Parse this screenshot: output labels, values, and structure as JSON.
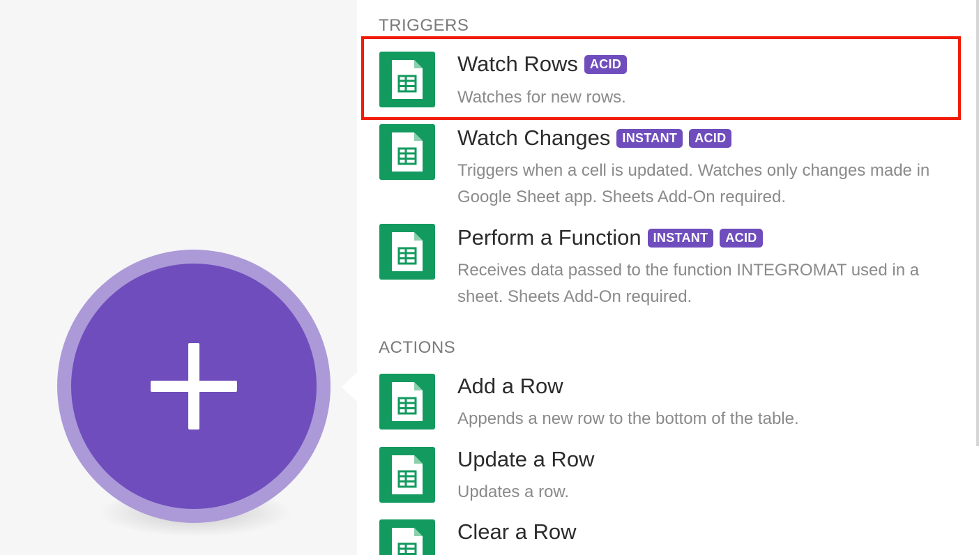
{
  "colors": {
    "accent": "#6f4dbd",
    "accent_ring": "#ac9ad8",
    "sheets_green": "#139a5f",
    "highlight": "#f21b05"
  },
  "add_module": {
    "icon": "plus-icon"
  },
  "triggers": {
    "title": "TRIGGERS",
    "items": [
      {
        "title": "Watch Rows",
        "badges": [
          "ACID"
        ],
        "description": "Watches for new rows.",
        "icon": "google-sheets-icon",
        "highlighted": true
      },
      {
        "title": "Watch Changes",
        "badges": [
          "INSTANT",
          "ACID"
        ],
        "description": "Triggers when a cell is updated. Watches only changes made in Google Sheet app. Sheets Add-On required.",
        "icon": "google-sheets-icon"
      },
      {
        "title": "Perform a Function",
        "badges": [
          "INSTANT",
          "ACID"
        ],
        "description": "Receives data passed to the function INTEGROMAT used in a sheet. Sheets Add-On required.",
        "icon": "google-sheets-icon"
      }
    ]
  },
  "actions": {
    "title": "ACTIONS",
    "items": [
      {
        "title": "Add a Row",
        "description": "Appends a new row to the bottom of the table.",
        "icon": "google-sheets-icon"
      },
      {
        "title": "Update a Row",
        "description": "Updates a row.",
        "icon": "google-sheets-icon"
      },
      {
        "title": "Clear a Row",
        "description": "",
        "icon": "google-sheets-icon"
      }
    ]
  }
}
